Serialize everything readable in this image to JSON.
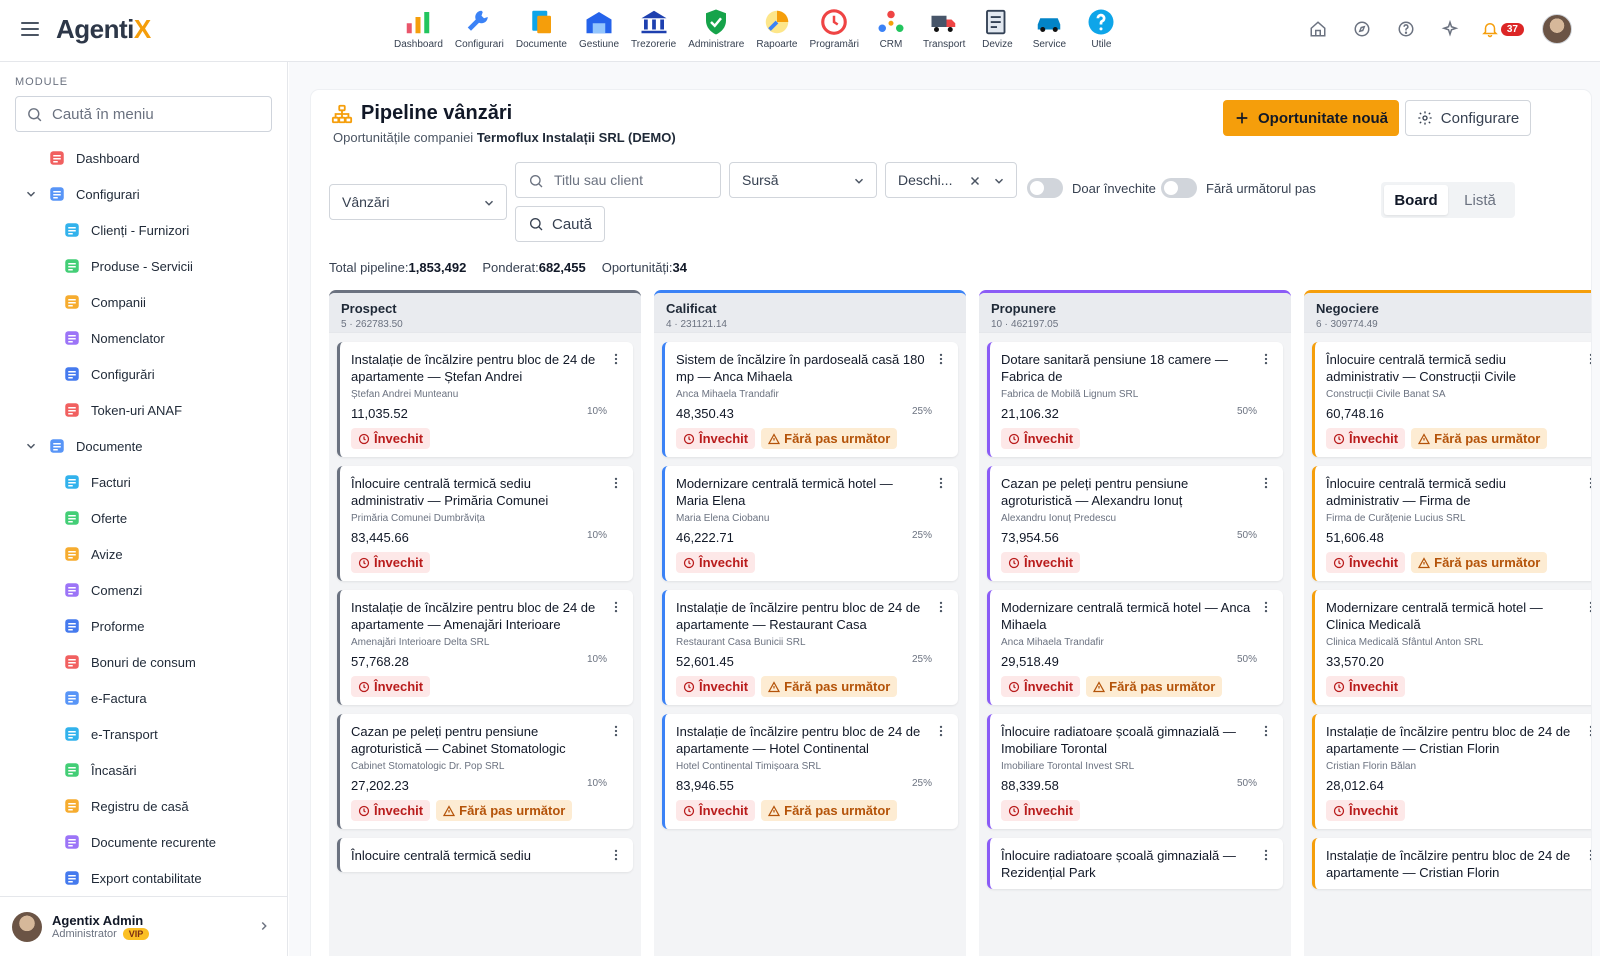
{
  "app": {
    "logo_main": "Agenti",
    "logo_accent": "X"
  },
  "top_modules": [
    {
      "label": "Dashboard",
      "icon": "dashboard-icon",
      "color": "#e9566b"
    },
    {
      "label": "Configurari",
      "icon": "wrench-icon",
      "color": "#3b82f6"
    },
    {
      "label": "Documente",
      "icon": "documents-icon",
      "color": "#0ea5e9"
    },
    {
      "label": "Gestiune",
      "icon": "warehouse-icon",
      "color": "#2563eb"
    },
    {
      "label": "Trezorerie",
      "icon": "bank-icon",
      "color": "#1e40af"
    },
    {
      "label": "Administrare",
      "icon": "shield-check-icon",
      "color": "#16a34a"
    },
    {
      "label": "Rapoarte",
      "icon": "reports-icon",
      "color": "#f59e0b"
    },
    {
      "label": "Programări",
      "icon": "clock-icon",
      "color": "#ef4444"
    },
    {
      "label": "CRM",
      "icon": "crm-icon",
      "color": "#22c55e"
    },
    {
      "label": "Transport",
      "icon": "truck-icon",
      "color": "#475569"
    },
    {
      "label": "Devize",
      "icon": "estimate-icon",
      "color": "#334155"
    },
    {
      "label": "Service",
      "icon": "car-service-icon",
      "color": "#0284c7"
    },
    {
      "label": "Utile",
      "icon": "help-circle-icon",
      "color": "#0ea5e9"
    }
  ],
  "header_right": {
    "notifications_count": "37"
  },
  "sidebar": {
    "title": "MODULE",
    "search_placeholder": "Caută în meniu",
    "items": [
      {
        "label": "Dashboard",
        "level": 0,
        "chevron": false
      },
      {
        "label": "Configurari",
        "level": 0,
        "chevron": true
      },
      {
        "label": "Clienți - Furnizori",
        "level": 1
      },
      {
        "label": "Produse - Servicii",
        "level": 1
      },
      {
        "label": "Companii",
        "level": 1
      },
      {
        "label": "Nomenclator",
        "level": 1
      },
      {
        "label": "Configurări",
        "level": 1
      },
      {
        "label": "Token-uri ANAF",
        "level": 1
      },
      {
        "label": "Documente",
        "level": 0,
        "chevron": true
      },
      {
        "label": "Facturi",
        "level": 1
      },
      {
        "label": "Oferte",
        "level": 1
      },
      {
        "label": "Avize",
        "level": 1
      },
      {
        "label": "Comenzi",
        "level": 1
      },
      {
        "label": "Proforme",
        "level": 1
      },
      {
        "label": "Bonuri de consum",
        "level": 1
      },
      {
        "label": "e-Factura",
        "level": 1
      },
      {
        "label": "e-Transport",
        "level": 1
      },
      {
        "label": "Încasări",
        "level": 1
      },
      {
        "label": "Registru de casă",
        "level": 1
      },
      {
        "label": "Documente recurente",
        "level": 1
      },
      {
        "label": "Export contabilitate",
        "level": 1
      }
    ],
    "user": {
      "name": "Agentix Admin",
      "role": "Administrator",
      "badge": "VIP"
    }
  },
  "page": {
    "title": "Pipeline vânzări",
    "subtitle_prefix": "Oportunitățile companiei ",
    "company": "Termoflux Instalații SRL (DEMO)",
    "new_button": "Oportunitate nouă",
    "config_button": "Configurare"
  },
  "filters": {
    "pipeline_select": "Vânzări",
    "search_placeholder": "Titlu sau client",
    "search_button": "Caută",
    "source_select": "Sursă",
    "status_select": "Deschi...",
    "toggle_stale": "Doar învechite",
    "toggle_no_next": "Fără următorul pas"
  },
  "view_switch": {
    "board": "Board",
    "list": "Listă"
  },
  "totals": {
    "total_label": "Total pipeline:",
    "total_value": "1,853,492",
    "weighted_label": "Ponderat:",
    "weighted_value": "682,455",
    "count_label": "Oportunități:",
    "count_value": "34"
  },
  "tag_labels": {
    "stale": "Învechit",
    "no_next": "Fără pas următor"
  },
  "columns": [
    {
      "name": "Prospect",
      "meta": "5 · 262783.50",
      "color": "#6b7280",
      "cards": [
        {
          "title": "Instalație de încălzire pentru bloc de 24 de apartamente — Ștefan Andrei",
          "client": "Ștefan Andrei Munteanu",
          "value": "11,035.52",
          "prob": "10%",
          "stale": true,
          "no_next": false
        },
        {
          "title": "Înlocuire centrală termică sediu administrativ — Primăria Comunei",
          "client": "Primăria Comunei Dumbrăvița",
          "value": "83,445.66",
          "prob": "10%",
          "stale": true,
          "no_next": false
        },
        {
          "title": "Instalație de încălzire pentru bloc de 24 de apartamente — Amenajări Interioare",
          "client": "Amenajări Interioare Delta SRL",
          "value": "57,768.28",
          "prob": "10%",
          "stale": true,
          "no_next": false
        },
        {
          "title": "Cazan pe peleți pentru pensiune agroturistică — Cabinet Stomatologic",
          "client": "Cabinet Stomatologic Dr. Pop SRL",
          "value": "27,202.23",
          "prob": "10%",
          "stale": true,
          "no_next": true
        },
        {
          "title": "Înlocuire centrală termică sediu",
          "client": "",
          "value": "",
          "prob": "",
          "stale": false,
          "no_next": false
        }
      ]
    },
    {
      "name": "Calificat",
      "meta": "4 · 231121.14",
      "color": "#3b82f6",
      "cards": [
        {
          "title": "Sistem de încălzire în pardoseală casă 180 mp — Anca Mihaela",
          "client": "Anca Mihaela Trandafir",
          "value": "48,350.43",
          "prob": "25%",
          "stale": true,
          "no_next": true
        },
        {
          "title": "Modernizare centrală termică hotel — Maria Elena",
          "client": "Maria Elena Ciobanu",
          "value": "46,222.71",
          "prob": "25%",
          "stale": true,
          "no_next": false
        },
        {
          "title": "Instalație de încălzire pentru bloc de 24 de apartamente — Restaurant Casa",
          "client": "Restaurant Casa Bunicii SRL",
          "value": "52,601.45",
          "prob": "25%",
          "stale": true,
          "no_next": true
        },
        {
          "title": "Instalație de încălzire pentru bloc de 24 de apartamente — Hotel Continental",
          "client": "Hotel Continental Timișoara SRL",
          "value": "83,946.55",
          "prob": "25%",
          "stale": true,
          "no_next": true
        }
      ]
    },
    {
      "name": "Propunere",
      "meta": "10 · 462197.05",
      "color": "#8b5cf6",
      "cards": [
        {
          "title": "Dotare sanitară pensiune 18 camere — Fabrica de",
          "client": "Fabrica de Mobilă Lignum SRL",
          "value": "21,106.32",
          "prob": "50%",
          "stale": true,
          "no_next": false
        },
        {
          "title": "Cazan pe peleți pentru pensiune agroturistică — Alexandru Ionuț",
          "client": "Alexandru Ionuț Predescu",
          "value": "73,954.56",
          "prob": "50%",
          "stale": true,
          "no_next": false
        },
        {
          "title": "Modernizare centrală termică hotel — Anca Mihaela",
          "client": "Anca Mihaela Trandafir",
          "value": "29,518.49",
          "prob": "50%",
          "stale": true,
          "no_next": true
        },
        {
          "title": "Înlocuire radiatoare școală gimnazială — Imobiliare Torontal",
          "client": "Imobiliare Torontal Invest SRL",
          "value": "88,339.58",
          "prob": "50%",
          "stale": true,
          "no_next": false
        },
        {
          "title": "Înlocuire radiatoare școală gimnazială — Rezidențial Park",
          "client": "",
          "value": "",
          "prob": "",
          "stale": false,
          "no_next": false
        }
      ]
    },
    {
      "name": "Negociere",
      "meta": "6 · 309774.49",
      "color": "#f59e0b",
      "cards": [
        {
          "title": "Înlocuire centrală termică sediu administrativ — Construcții Civile",
          "client": "Construcții Civile Banat SA",
          "value": "60,748.16",
          "prob": "",
          "stale": true,
          "no_next": true
        },
        {
          "title": "Înlocuire centrală termică sediu administrativ — Firma de",
          "client": "Firma de Curățenie Lucius SRL",
          "value": "51,606.48",
          "prob": "",
          "stale": true,
          "no_next": true
        },
        {
          "title": "Modernizare centrală termică hotel — Clinica Medicală",
          "client": "Clinica Medicală Sfântul Anton SRL",
          "value": "33,570.20",
          "prob": "",
          "stale": true,
          "no_next": false
        },
        {
          "title": "Instalație de încălzire pentru bloc de 24 de apartamente — Cristian Florin",
          "client": "Cristian Florin Bălan",
          "value": "28,012.64",
          "prob": "",
          "stale": true,
          "no_next": false
        },
        {
          "title": "Instalație de încălzire pentru bloc de 24 de apartamente — Cristian Florin",
          "client": "",
          "value": "",
          "prob": "",
          "stale": false,
          "no_next": false
        }
      ]
    }
  ]
}
